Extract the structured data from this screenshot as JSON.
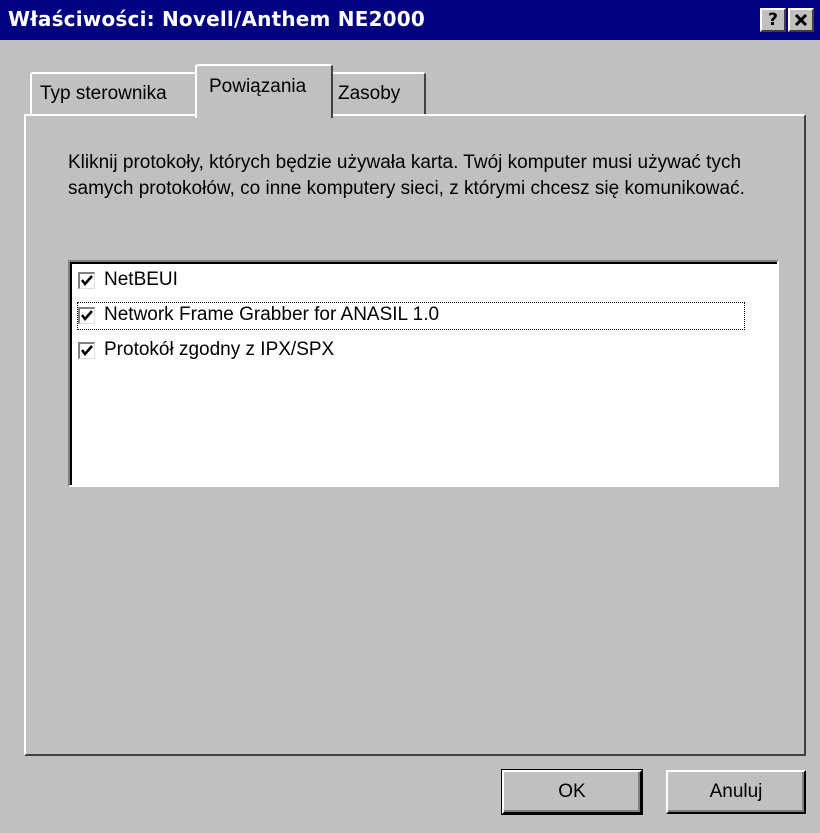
{
  "window": {
    "title": "Właściwości: Novell/Anthem NE2000",
    "help_label": "?",
    "close_label": "✕"
  },
  "tabs": [
    {
      "label": "Typ sterownika",
      "active": false
    },
    {
      "label": "Powiązania",
      "active": true
    },
    {
      "label": "Zasoby",
      "active": false
    }
  ],
  "bindings": {
    "description": "Kliknij protokoły, których będzie używała karta. Twój komputer musi używać tych samych protokołów, co inne komputery sieci, z którymi chcesz się komunikować.",
    "items": [
      {
        "label": "NetBEUI",
        "checked": true
      },
      {
        "label": "Network Frame Grabber for ANASIL 1.0",
        "checked": true
      },
      {
        "label": "Protokół zgodny z IPX/SPX",
        "checked": true
      }
    ]
  },
  "buttons": {
    "ok_label": "OK",
    "cancel_label": "Anuluj"
  },
  "colors": {
    "titlebar": "#000080",
    "face": "#c0c0c0",
    "list_bg": "#ffffff"
  },
  "icons": {
    "check": "checkmark-icon"
  }
}
